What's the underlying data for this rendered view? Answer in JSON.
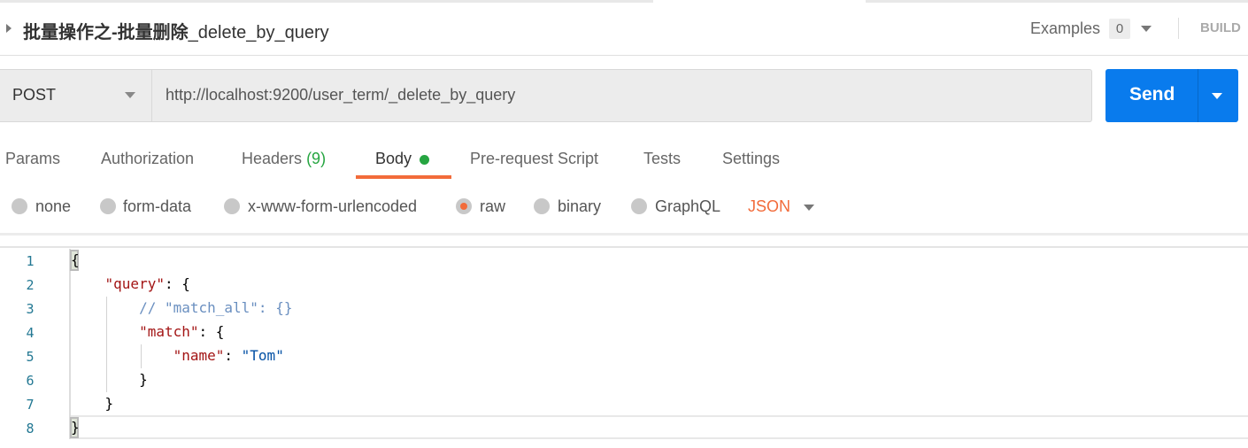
{
  "request": {
    "title_cn": "批量操作之-批量删除",
    "title_en": "_delete_by_query",
    "examples_label": "Examples",
    "examples_count": "0",
    "build_label": "BUILD"
  },
  "urlbar": {
    "method": "POST",
    "url": "http://localhost:9200/user_term/_delete_by_query",
    "send_label": "Send"
  },
  "tabs": [
    {
      "label": "Params"
    },
    {
      "label": "Authorization"
    },
    {
      "label": "Headers",
      "count": "(9)"
    },
    {
      "label": "Body",
      "active": true
    },
    {
      "label": "Pre-request Script"
    },
    {
      "label": "Tests"
    },
    {
      "label": "Settings"
    }
  ],
  "body_types": [
    {
      "label": "none"
    },
    {
      "label": "form-data"
    },
    {
      "label": "x-www-form-urlencoded"
    },
    {
      "label": "raw",
      "selected": true
    },
    {
      "label": "binary"
    },
    {
      "label": "GraphQL"
    }
  ],
  "format": "JSON",
  "colors": {
    "send": "#097bed",
    "accent": "#f26b3a",
    "indicator": "#26a541"
  },
  "editor": {
    "lines": [
      [
        [
          "p",
          "{"
        ]
      ],
      [
        [
          "p",
          "    "
        ],
        [
          "k",
          "\"query\""
        ],
        [
          "p",
          ": {"
        ]
      ],
      [
        [
          "p",
          "        "
        ],
        [
          "c",
          "// \"match_all\": {}"
        ]
      ],
      [
        [
          "p",
          "        "
        ],
        [
          "k",
          "\"match\""
        ],
        [
          "p",
          ": {"
        ]
      ],
      [
        [
          "p",
          "            "
        ],
        [
          "k",
          "\"name\""
        ],
        [
          "p",
          ": "
        ],
        [
          "s",
          "\"Tom\""
        ]
      ],
      [
        [
          "p",
          "        }"
        ]
      ],
      [
        [
          "p",
          "    }"
        ]
      ],
      [
        [
          "p",
          "}"
        ]
      ]
    ]
  }
}
